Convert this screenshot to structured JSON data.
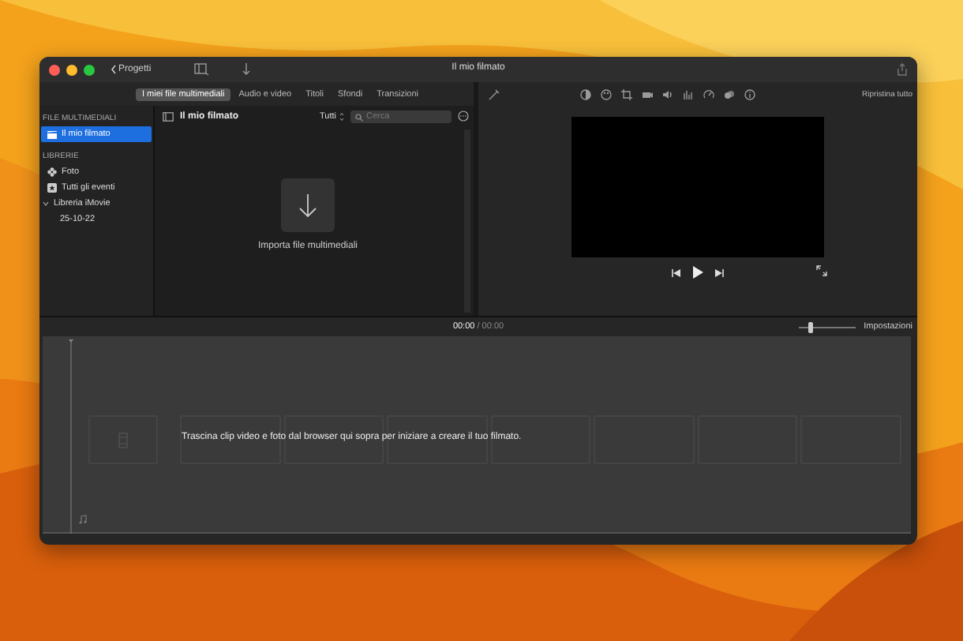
{
  "window": {
    "title": "Il mio filmato",
    "back_label": "Progetti"
  },
  "tabs": [
    {
      "label": "I miei file multimediali",
      "selected": true
    },
    {
      "label": "Audio e video",
      "selected": false
    },
    {
      "label": "Titoli",
      "selected": false
    },
    {
      "label": "Sfondi",
      "selected": false
    },
    {
      "label": "Transizioni",
      "selected": false
    }
  ],
  "sidebar": {
    "sections": [
      {
        "heading": "FILE MULTIMEDIALI",
        "items": [
          {
            "label": "Il mio filmato",
            "kind": "film",
            "selected": true,
            "expanded": false
          }
        ]
      },
      {
        "heading": "LIBRERIE",
        "items": [
          {
            "label": "Foto",
            "kind": "photos",
            "selected": false,
            "expanded": false
          },
          {
            "label": "Tutti gli eventi",
            "kind": "star",
            "selected": false,
            "expanded": false
          },
          {
            "label": "Libreria iMovie",
            "selected": false,
            "expanded": true,
            "children": [
              {
                "label": "25-10-22",
                "selected": false,
                "expanded": false
              }
            ]
          }
        ]
      }
    ]
  },
  "browser": {
    "title": "Il mio filmato",
    "filter": "Tutti",
    "search": {
      "placeholder": "Cerca"
    },
    "import_label": "Importa file multimediali"
  },
  "viewer": {
    "reset_label": "Ripristina tutto"
  },
  "timeline": {
    "current_time": "00:00",
    "separator": "/",
    "total_time": "00:00",
    "zoom": {
      "level": 0.2
    },
    "settings_label": "Impostazioni",
    "hint": "Trascina clip video e foto dal browser qui sopra per iniziare a creare il tuo filmato."
  }
}
